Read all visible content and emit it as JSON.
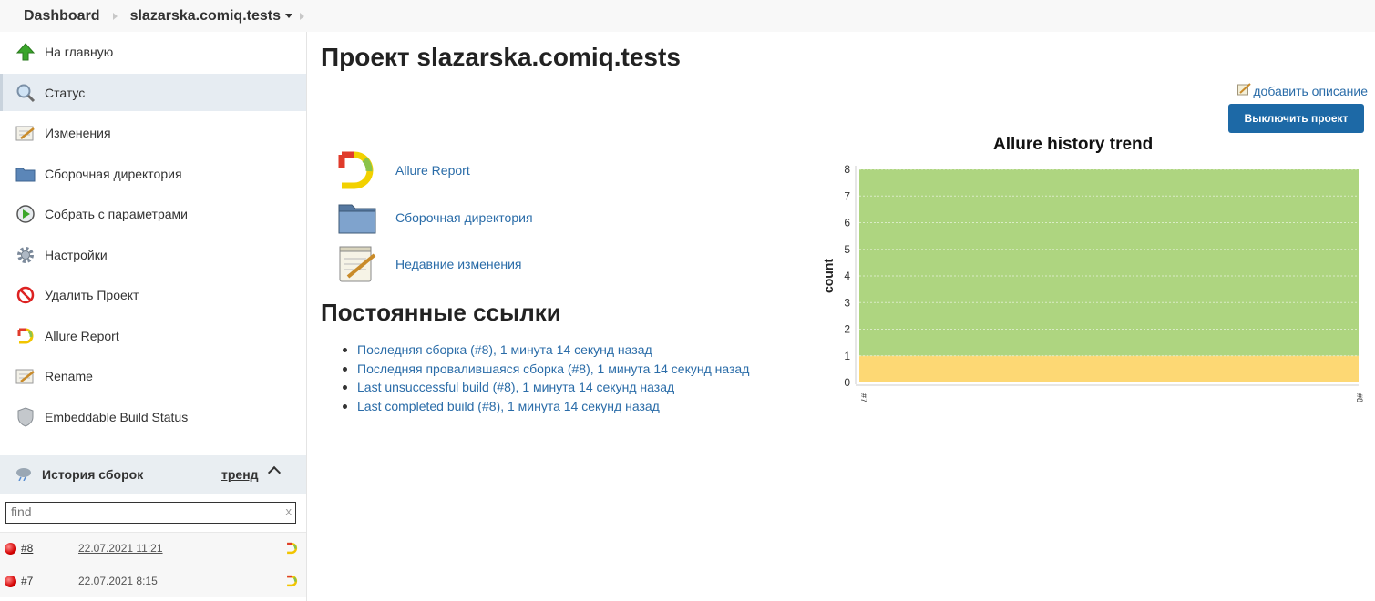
{
  "breadcrumb": {
    "dashboard": "Dashboard",
    "project": "slazarska.comiq.tests"
  },
  "sidebar": {
    "items": [
      {
        "label": "На главную",
        "icon": "up-arrow-icon"
      },
      {
        "label": "Статус",
        "icon": "search-icon"
      },
      {
        "label": "Изменения",
        "icon": "notepad-icon"
      },
      {
        "label": "Сборочная директория",
        "icon": "folder-icon"
      },
      {
        "label": "Собрать с параметрами",
        "icon": "clock-build-icon"
      },
      {
        "label": "Настройки",
        "icon": "gear-icon"
      },
      {
        "label": "Удалить Проект",
        "icon": "no-entry-icon"
      },
      {
        "label": "Allure Report",
        "icon": "allure-icon"
      },
      {
        "label": "Rename",
        "icon": "notepad-icon"
      },
      {
        "label": "Embeddable Build Status",
        "icon": "shield-icon"
      }
    ],
    "active_index": 1
  },
  "history": {
    "title": "История сборок",
    "trend_label": "тренд",
    "find_placeholder": "find",
    "find_clear": "x",
    "builds": [
      {
        "number": "#8",
        "date": "22.07.2021 11:21",
        "status": "failed"
      },
      {
        "number": "#7",
        "date": "22.07.2021 8:15",
        "status": "failed"
      }
    ]
  },
  "main": {
    "title": "Проект slazarska.comiq.tests",
    "add_description": "добавить описание",
    "disable_button": "Выключить проект",
    "links": [
      {
        "label": "Allure Report",
        "icon": "allure-icon"
      },
      {
        "label": "Сборочная директория",
        "icon": "folder-icon"
      },
      {
        "label": "Недавние изменения",
        "icon": "notepad-icon"
      }
    ],
    "permalinks_title": "Постоянные ссылки",
    "permalinks": [
      "Последняя сборка (#8), 1 минута 14 секунд назад",
      "Последняя провалившаяся сборка (#8), 1 минута 14 секунд назад",
      "Last unsuccessful build (#8), 1 минута 14 секунд назад",
      "Last completed build (#8), 1 минута 14 секунд назад"
    ]
  },
  "colors": {
    "link": "#2a6ca8",
    "button": "#1d69a6",
    "passed": "#aed580",
    "broken": "#fdd874"
  },
  "chart_data": {
    "type": "area",
    "title": "Allure history trend",
    "xlabel": "",
    "ylabel": "count",
    "categories": [
      "#7",
      "#8"
    ],
    "ylim": [
      0,
      8
    ],
    "yticks": [
      0,
      1,
      2,
      3,
      4,
      5,
      6,
      7,
      8
    ],
    "stacked": true,
    "grid": true,
    "series": [
      {
        "values": [
          1,
          1
        ],
        "color": "#fdd874"
      },
      {
        "values": [
          7,
          7
        ],
        "color": "#aed580"
      }
    ]
  }
}
